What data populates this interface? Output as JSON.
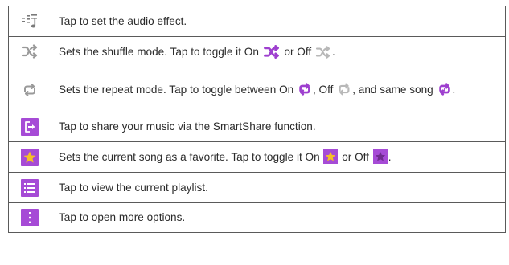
{
  "rows": [
    {
      "icon": "equalizer-music-icon",
      "parts": [
        "Tap to set the audio effect."
      ]
    },
    {
      "icon": "shuffle-icon",
      "parts": [
        "Sets the shuffle mode. Tap to toggle it On ",
        " or Off ",
        "."
      ]
    },
    {
      "icon": "repeat-icon",
      "parts": [
        "Sets the repeat mode. Tap to toggle between On ",
        ", Off ",
        ", and same song ",
        "."
      ]
    },
    {
      "icon": "smartshare-icon",
      "parts": [
        "Tap to share your music via the SmartShare function."
      ]
    },
    {
      "icon": "favorite-star-icon",
      "parts": [
        "Sets the current song as a favorite. Tap to toggle it On ",
        " or Off ",
        "."
      ]
    },
    {
      "icon": "playlist-icon",
      "parts": [
        "Tap to view the current playlist."
      ]
    },
    {
      "icon": "more-options-icon",
      "parts": [
        "Tap to open more options."
      ]
    }
  ],
  "colors": {
    "tile_purple": "#a64bd6",
    "active_purple": "#9e3fcf",
    "inactive_gray": "#b8b8b8",
    "star_gold": "#f5c026",
    "star_dark_purple": "#6f2b8f",
    "border": "#5a5a5a",
    "text": "#2b2b2b"
  }
}
